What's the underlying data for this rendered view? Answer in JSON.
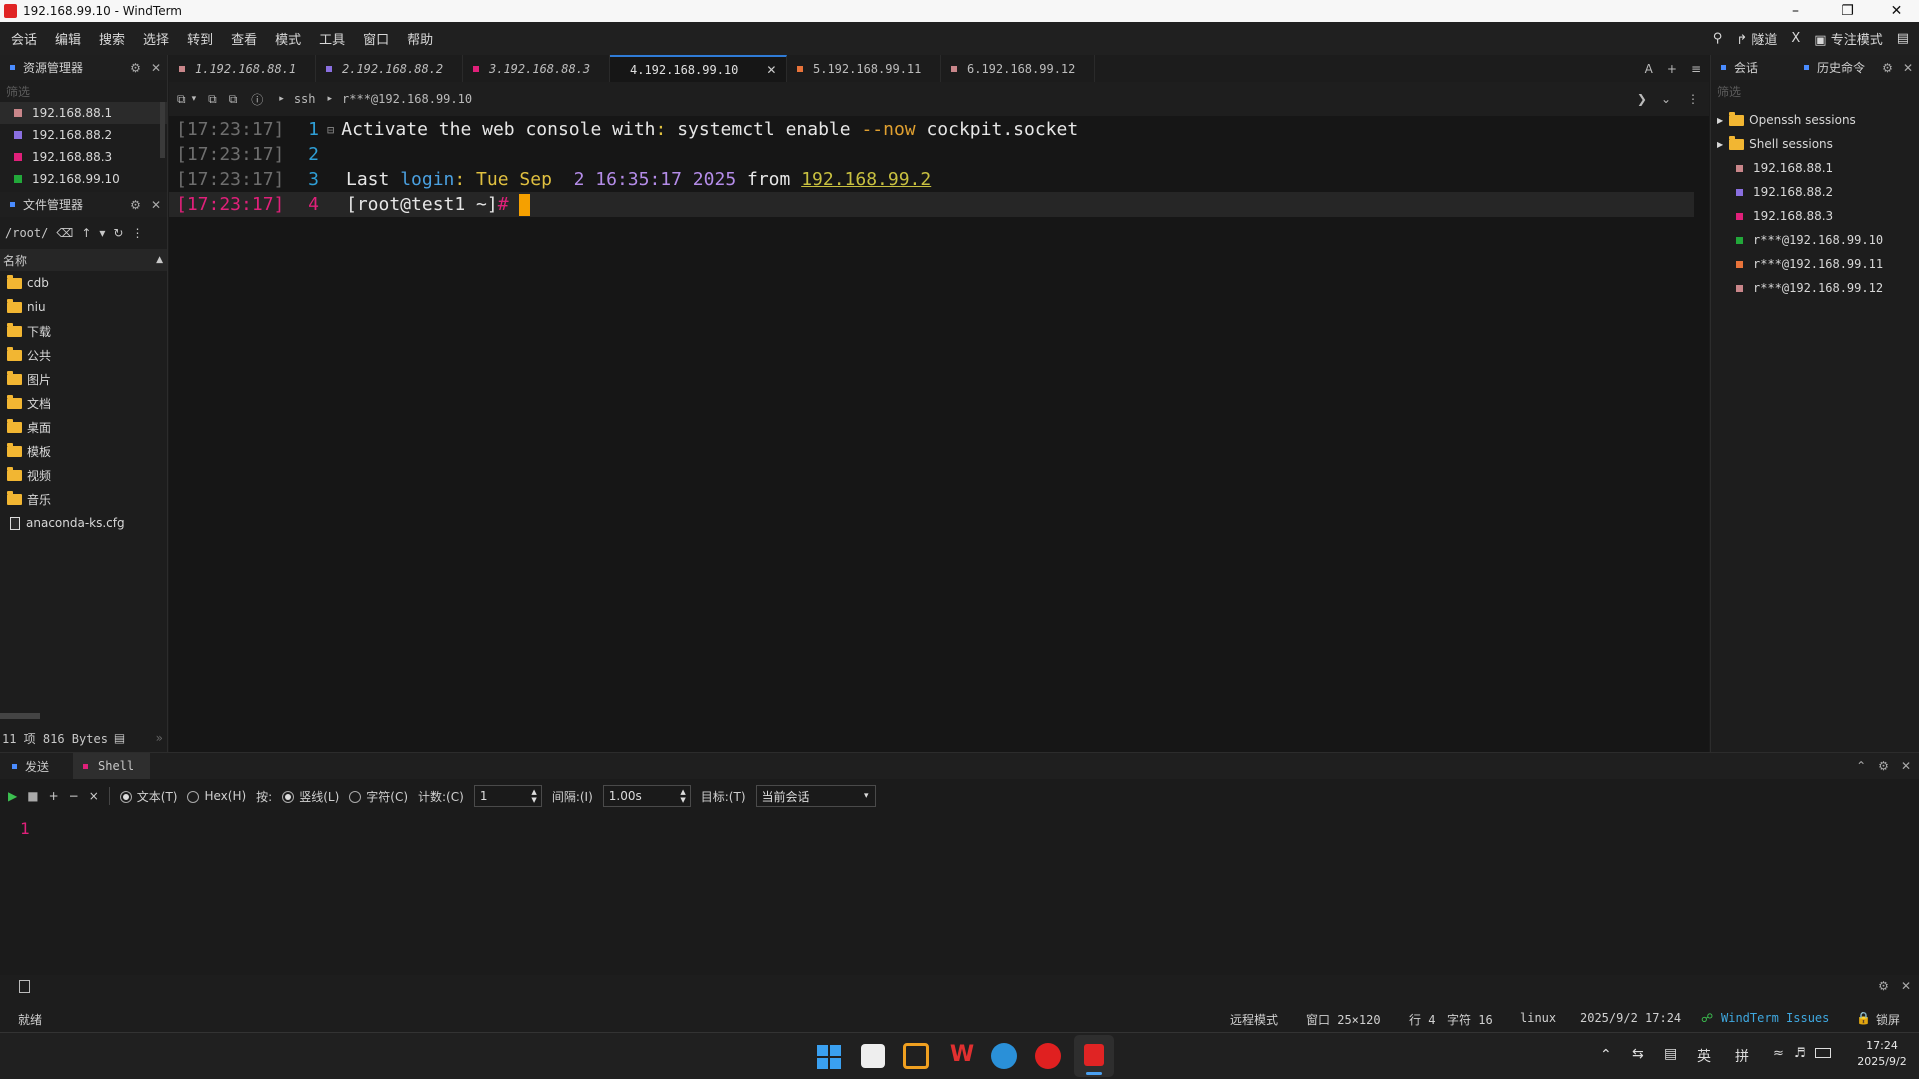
{
  "window": {
    "title": "192.168.99.10 - WindTerm"
  },
  "menu": [
    "会话",
    "编辑",
    "搜索",
    "选择",
    "转到",
    "查看",
    "模式",
    "工具",
    "窗口",
    "帮助"
  ],
  "menu_right": {
    "tunnel": "隧道",
    "x": "X",
    "focus": "专注模式"
  },
  "explorer": {
    "title": "资源管理器",
    "filter_placeholder": "筛选",
    "sessions": [
      {
        "label": "192.168.88.1",
        "color": "#c9868a"
      },
      {
        "label": "192.168.88.2",
        "color": "#8a6fe0"
      },
      {
        "label": "192.168.88.3",
        "color": "#e0207a"
      },
      {
        "label": "192.168.99.10",
        "color": "#22a83a"
      }
    ]
  },
  "filemanager": {
    "title": "文件管理器",
    "path": "/root/",
    "column_name": "名称",
    "items": [
      {
        "name": "cdb",
        "type": "folder"
      },
      {
        "name": "niu",
        "type": "folder"
      },
      {
        "name": "下载",
        "type": "folder"
      },
      {
        "name": "公共",
        "type": "folder"
      },
      {
        "name": "图片",
        "type": "folder"
      },
      {
        "name": "文档",
        "type": "folder"
      },
      {
        "name": "桌面",
        "type": "folder"
      },
      {
        "name": "模板",
        "type": "folder"
      },
      {
        "name": "视频",
        "type": "folder"
      },
      {
        "name": "音乐",
        "type": "folder"
      },
      {
        "name": "anaconda-ks.cfg",
        "type": "file"
      }
    ],
    "summary": "11 项 816 Bytes"
  },
  "tabs": [
    {
      "label": "1.192.168.88.1",
      "color": "#c9868a",
      "italic": true
    },
    {
      "label": "2.192.168.88.2",
      "color": "#8a6fe0",
      "italic": true
    },
    {
      "label": "3.192.168.88.3",
      "color": "#e0207a",
      "italic": true
    },
    {
      "label": "4.192.168.99.10",
      "color": "#22a83a",
      "italic": false
    },
    {
      "label": "5.192.168.99.11",
      "color": "#e8733a",
      "italic": false
    },
    {
      "label": "6.192.168.99.12",
      "color": "#c9868a",
      "italic": false
    }
  ],
  "tabs_right": {
    "a": "A",
    "plus": "+",
    "menu": "≡"
  },
  "toolbar": {
    "protocol": "ssh",
    "target": "r***@192.168.99.10"
  },
  "terminal": {
    "lines": [
      {
        "ts": "[17:23:17]",
        "num": "1"
      },
      {
        "ts": "[17:23:17]",
        "num": "2"
      },
      {
        "ts": "[17:23:17]",
        "num": "3"
      },
      {
        "ts": "[17:23:17]",
        "num": "4"
      }
    ],
    "line1": {
      "a": "Activate the web console with",
      "b": ":",
      "c": " systemctl enable ",
      "d": "--now",
      "e": " cockpit.socket"
    },
    "line3": {
      "a": "Last ",
      "b": "login",
      "c": ":",
      "d": " Tue Sep ",
      "e": " 2 16:35:17 2025",
      "f": " from ",
      "g": "192.168.99.2"
    },
    "line4": {
      "a": "[root@test1 ~]",
      "b": "#"
    }
  },
  "right_panel": {
    "tab_sessions": "会话",
    "tab_history": "历史命令",
    "filter_placeholder": "筛选",
    "groups": [
      "Openssh sessions",
      "Shell sessions"
    ],
    "items": [
      {
        "label": "192.168.88.1",
        "color": "#c9868a"
      },
      {
        "label": "192.168.88.2",
        "color": "#8a6fe0"
      },
      {
        "label": "192.168.88.3",
        "color": "#e0207a"
      },
      {
        "label": "r***@192.168.99.10",
        "color": "#22a83a"
      },
      {
        "label": "r***@192.168.99.11",
        "color": "#e8733a"
      },
      {
        "label": "r***@192.168.99.12",
        "color": "#c9868a"
      }
    ]
  },
  "sender": {
    "tab_send": "发送",
    "tab_shell": "Shell",
    "opt_text": "文本(T)",
    "opt_hex": "Hex(H)",
    "by": "按:",
    "opt_line": "竖线(L)",
    "opt_char": "字符(C)",
    "count_label": "计数:(C)",
    "count_value": "1",
    "interval_label": "间隔:(I)",
    "interval_value": "1.00s",
    "target_label": "目标:(T)",
    "target_value": "当前会话",
    "editor_line": "1"
  },
  "status": {
    "ready": "就绪",
    "mode": "远程模式",
    "window": "窗口 25×120",
    "row": "行 4",
    "col": "字符 16",
    "os": "linux",
    "datetime": "2025/9/2 17:24",
    "issues": "WindTerm Issues",
    "lock": "锁屏"
  },
  "taskbar": {
    "ime1": "英",
    "ime2": "拼",
    "time": "17:24",
    "date": "2025/9/2"
  }
}
